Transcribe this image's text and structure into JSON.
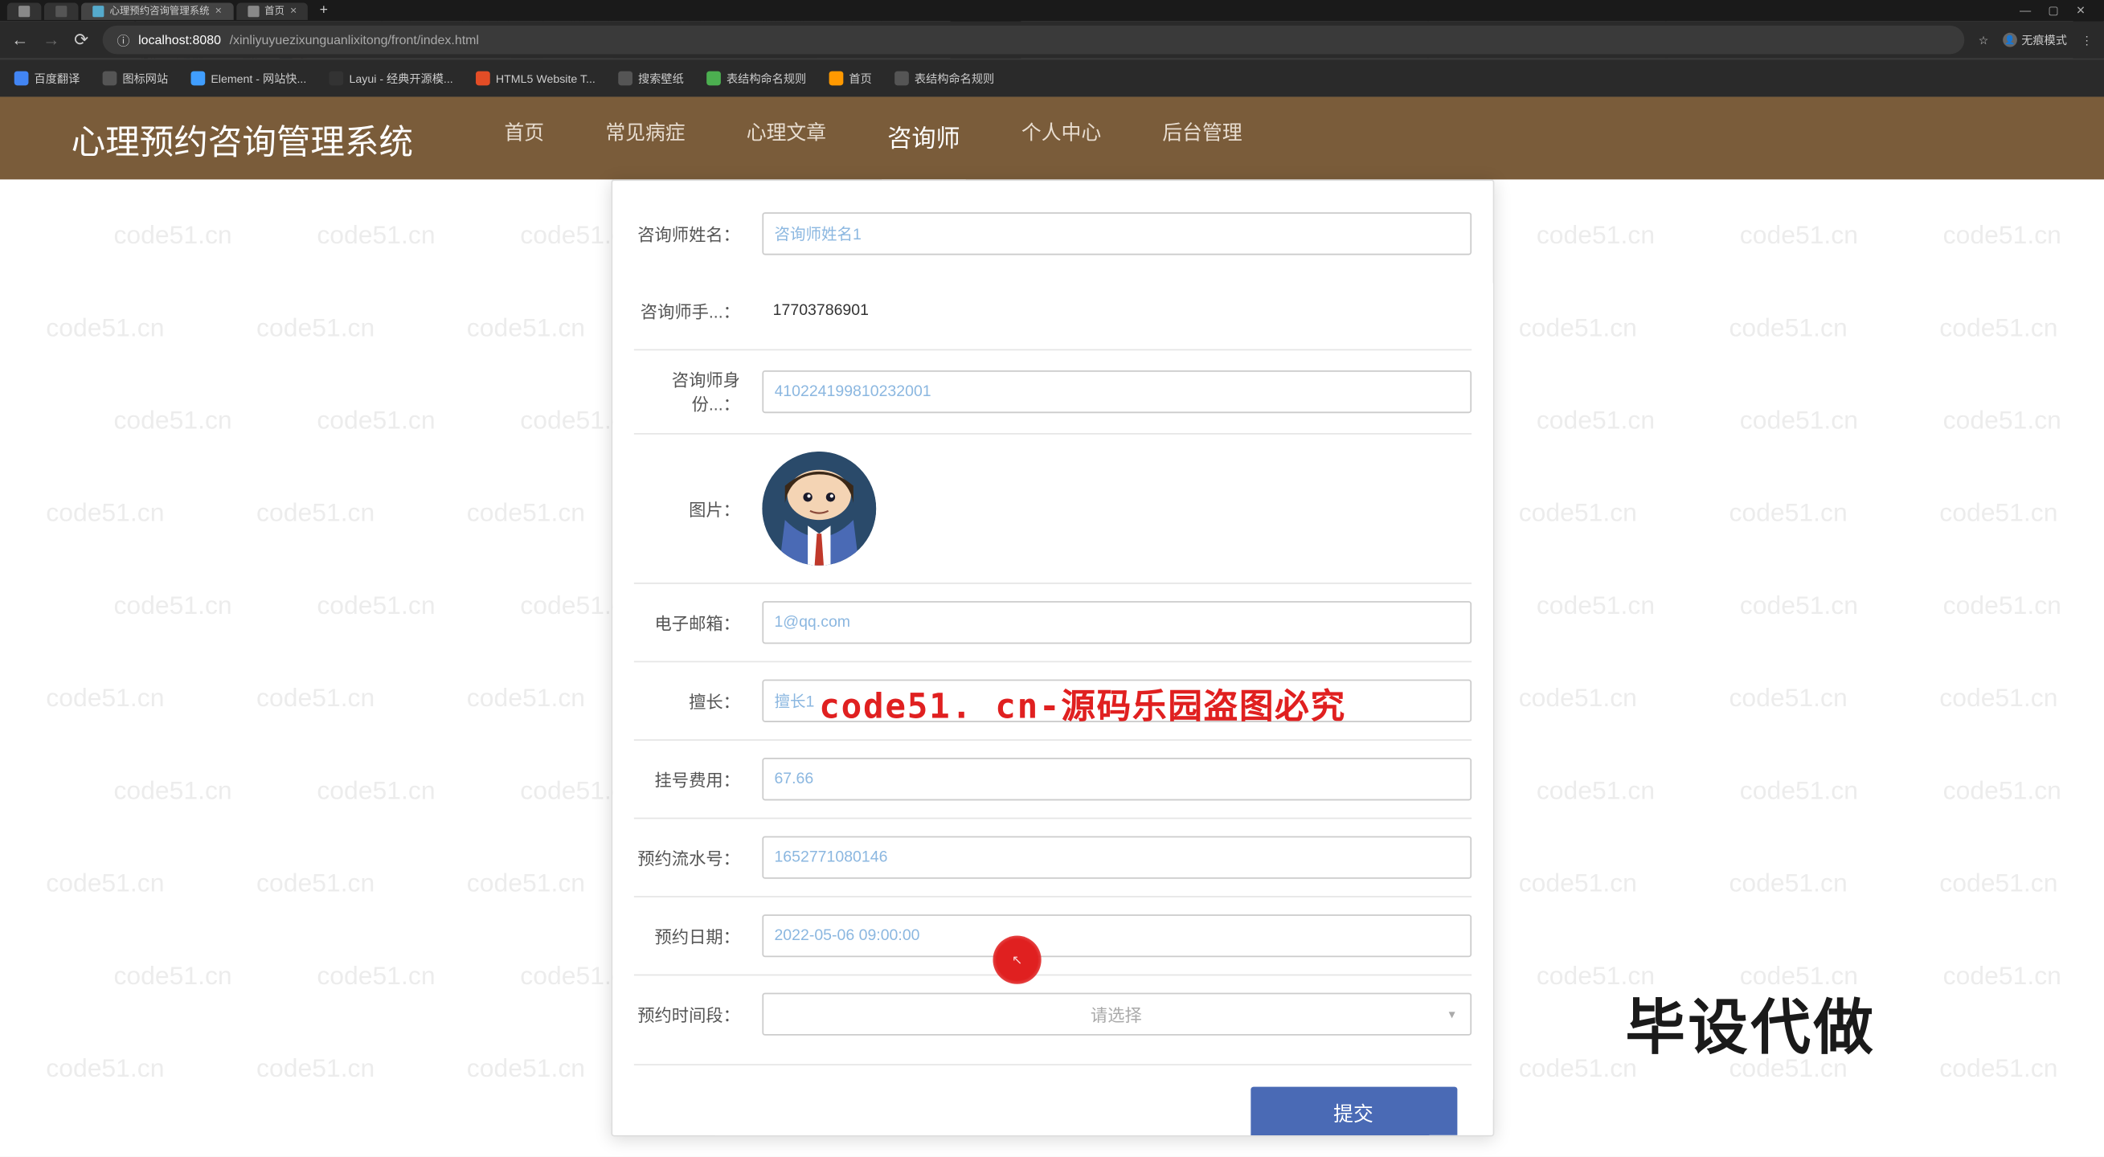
{
  "browser": {
    "tabs": [
      {
        "title": "心理预约咨询管理系统"
      },
      {
        "title": "首页"
      }
    ],
    "url_host": "localhost:8080",
    "url_path": "/xinliyuyuezixunguanlixitong/front/index.html",
    "mode_label": "无痕模式",
    "bookmarks": [
      {
        "label": "百度翻译",
        "color": "#4285f4"
      },
      {
        "label": "图标网站",
        "color": "#555"
      },
      {
        "label": "Element - 网站快...",
        "color": "#409eff"
      },
      {
        "label": "Layui - 经典开源模...",
        "color": "#333"
      },
      {
        "label": "HTML5 Website T...",
        "color": "#e44d26"
      },
      {
        "label": "搜索壁纸",
        "color": "#555"
      },
      {
        "label": "表结构命名规则",
        "color": "#4caf50"
      },
      {
        "label": "首页",
        "color": "#f90"
      },
      {
        "label": "表结构命名规则",
        "color": "#555"
      }
    ]
  },
  "header": {
    "logo": "心理预约咨询管理系统",
    "nav": [
      "首页",
      "常见病症",
      "心理文章",
      "咨询师",
      "个人中心",
      "后台管理"
    ],
    "active": "咨询师"
  },
  "form": {
    "labels": {
      "name": "咨询师姓名：",
      "phone": "咨询师手...：",
      "idcard": "咨询师身份...：",
      "photo": "图片：",
      "email": "电子邮箱：",
      "skill": "擅长：",
      "fee": "挂号费用：",
      "serial": "预约流水号：",
      "date": "预约日期：",
      "timeslot": "预约时间段："
    },
    "values": {
      "name": "咨询师姓名1",
      "phone": "17703786901",
      "idcard": "410224199810232001",
      "email": "1@qq.com",
      "skill": "擅长1",
      "fee": "67.66",
      "serial": "1652771080146",
      "date": "2022-05-06 09:00:00",
      "timeslot_placeholder": "请选择"
    },
    "submit": "提交"
  },
  "watermark": "code51.cn",
  "overlay_text": "code51. cn-源码乐园盗图必究",
  "big_text": "毕设代做"
}
